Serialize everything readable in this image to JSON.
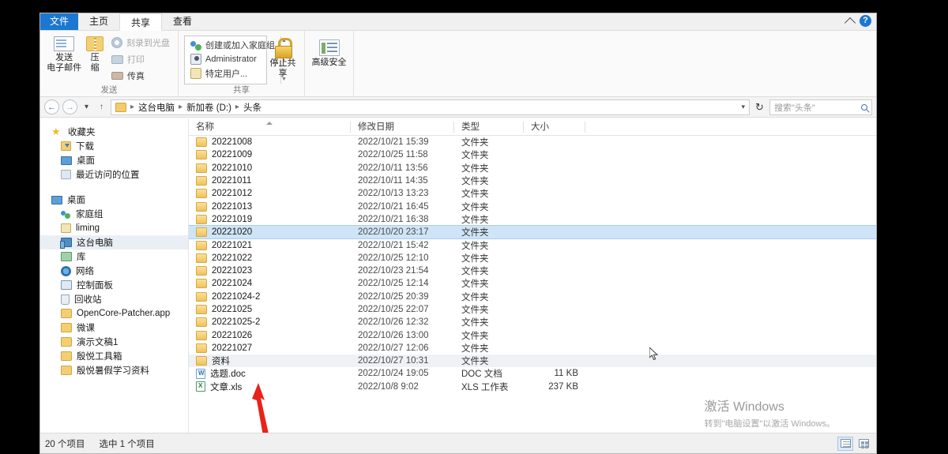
{
  "window": {
    "tabs": [
      {
        "label": "文件",
        "style": "file"
      },
      {
        "label": "主页",
        "style": "normal"
      },
      {
        "label": "共享",
        "style": "active"
      },
      {
        "label": "查看",
        "style": "normal"
      }
    ],
    "collapse_icon": "chevron-up-icon",
    "help_icon": "help-icon",
    "help_label": "?"
  },
  "ribbon": {
    "groups": [
      {
        "label": "发送",
        "big_buttons": [
          {
            "line1": "发送",
            "line2": "电子邮件",
            "icon": "email-icon"
          },
          {
            "line1": "压",
            "line2": "缩",
            "icon": "zip-folder-icon"
          }
        ],
        "small_buttons": [
          {
            "label": "刻录到光盘",
            "icon": "disc-icon",
            "disabled": true
          },
          {
            "label": "打印",
            "icon": "print-icon",
            "disabled": true
          },
          {
            "label": "传真",
            "icon": "fax-icon",
            "disabled": false
          }
        ]
      },
      {
        "label": "共享",
        "list_items": [
          {
            "label": "创建或加入家庭组",
            "icon": "homegroup-icon"
          },
          {
            "label": "Administrator",
            "icon": "user-icon"
          },
          {
            "label": "特定用户...",
            "icon": "users-icon"
          }
        ],
        "big_buttons": [
          {
            "line1": "停止共享",
            "line2": "",
            "icon": "lock-icon"
          }
        ]
      },
      {
        "label": "",
        "big_buttons": [
          {
            "line1": "高级安全",
            "line2": "",
            "icon": "advanced-security-icon"
          }
        ]
      }
    ]
  },
  "addressbar": {
    "back_icon": "back-arrow-icon",
    "forward_icon": "forward-arrow-icon",
    "history_icon": "chevron-down-icon",
    "up_icon": "up-arrow-icon",
    "breadcrumbs": [
      "这台电脑",
      "新加卷 (D:)",
      "头条"
    ],
    "dropdown_icon": "chevron-down-icon",
    "refresh_icon": "refresh-icon",
    "refresh_glyph": "↻",
    "search_placeholder": "搜索\"头条\"",
    "search_icon": "search-icon"
  },
  "sidebar": {
    "sections": [
      {
        "items": [
          {
            "label": "收藏夹",
            "icon": "star-icon",
            "indent": false,
            "selected": false
          },
          {
            "label": "下载",
            "icon": "downloads-icon",
            "indent": true,
            "selected": false
          },
          {
            "label": "桌面",
            "icon": "desktop-icon",
            "indent": true,
            "selected": false
          },
          {
            "label": "最近访问的位置",
            "icon": "recent-places-icon",
            "indent": true,
            "selected": false
          }
        ]
      },
      {
        "items": [
          {
            "label": "桌面",
            "icon": "desktop-icon",
            "indent": false,
            "selected": false
          },
          {
            "label": "家庭组",
            "icon": "homegroup-icon",
            "indent": true,
            "selected": false
          },
          {
            "label": "liming",
            "icon": "user-folder-icon",
            "indent": true,
            "selected": false
          },
          {
            "label": "这台电脑",
            "icon": "this-pc-icon",
            "indent": true,
            "selected": true
          },
          {
            "label": "库",
            "icon": "library-icon",
            "indent": true,
            "selected": false
          },
          {
            "label": "网络",
            "icon": "network-icon",
            "indent": true,
            "selected": false
          },
          {
            "label": "控制面板",
            "icon": "control-panel-icon",
            "indent": true,
            "selected": false
          },
          {
            "label": "回收站",
            "icon": "recycle-bin-icon",
            "indent": true,
            "selected": false
          },
          {
            "label": "OpenCore-Patcher.app",
            "icon": "folder-icon",
            "indent": true,
            "selected": false
          },
          {
            "label": "微课",
            "icon": "folder-icon",
            "indent": true,
            "selected": false
          },
          {
            "label": "演示文稿1",
            "icon": "folder-icon",
            "indent": true,
            "selected": false
          },
          {
            "label": "殷悦工具箱",
            "icon": "folder-icon",
            "indent": true,
            "selected": false
          },
          {
            "label": "殷悦暑假学习资料",
            "icon": "folder-icon",
            "indent": true,
            "selected": false
          }
        ]
      }
    ]
  },
  "filelist": {
    "columns": [
      {
        "key": "name",
        "label": "名称",
        "sorted": "asc"
      },
      {
        "key": "date",
        "label": "修改日期",
        "sorted": ""
      },
      {
        "key": "type",
        "label": "类型",
        "sorted": ""
      },
      {
        "key": "size",
        "label": "大小",
        "sorted": ""
      }
    ],
    "rows": [
      {
        "name": "20221008",
        "date": "2022/10/21 15:39",
        "type": "文件夹",
        "size": "",
        "icon": "folder-icon",
        "state": ""
      },
      {
        "name": "20221009",
        "date": "2022/10/25 11:58",
        "type": "文件夹",
        "size": "",
        "icon": "folder-icon",
        "state": ""
      },
      {
        "name": "20221010",
        "date": "2022/10/11 13:56",
        "type": "文件夹",
        "size": "",
        "icon": "folder-icon",
        "state": ""
      },
      {
        "name": "20221011",
        "date": "2022/10/11 14:35",
        "type": "文件夹",
        "size": "",
        "icon": "folder-icon",
        "state": ""
      },
      {
        "name": "20221012",
        "date": "2022/10/13 13:23",
        "type": "文件夹",
        "size": "",
        "icon": "folder-icon",
        "state": ""
      },
      {
        "name": "20221013",
        "date": "2022/10/21 16:45",
        "type": "文件夹",
        "size": "",
        "icon": "folder-icon",
        "state": ""
      },
      {
        "name": "20221019",
        "date": "2022/10/21 16:38",
        "type": "文件夹",
        "size": "",
        "icon": "folder-icon",
        "state": ""
      },
      {
        "name": "20221020",
        "date": "2022/10/20 23:17",
        "type": "文件夹",
        "size": "",
        "icon": "folder-icon",
        "state": "selected"
      },
      {
        "name": "20221021",
        "date": "2022/10/21 15:42",
        "type": "文件夹",
        "size": "",
        "icon": "folder-icon",
        "state": ""
      },
      {
        "name": "20221022",
        "date": "2022/10/25 12:10",
        "type": "文件夹",
        "size": "",
        "icon": "folder-icon",
        "state": ""
      },
      {
        "name": "20221023",
        "date": "2022/10/23 21:54",
        "type": "文件夹",
        "size": "",
        "icon": "folder-icon",
        "state": ""
      },
      {
        "name": "20221024",
        "date": "2022/10/25 12:14",
        "type": "文件夹",
        "size": "",
        "icon": "folder-icon",
        "state": ""
      },
      {
        "name": "20221024-2",
        "date": "2022/10/25 20:39",
        "type": "文件夹",
        "size": "",
        "icon": "folder-icon",
        "state": ""
      },
      {
        "name": "20221025",
        "date": "2022/10/25 22:07",
        "type": "文件夹",
        "size": "",
        "icon": "folder-icon",
        "state": ""
      },
      {
        "name": "20221025-2",
        "date": "2022/10/26 12:32",
        "type": "文件夹",
        "size": "",
        "icon": "folder-icon",
        "state": ""
      },
      {
        "name": "20221026",
        "date": "2022/10/26 13:00",
        "type": "文件夹",
        "size": "",
        "icon": "folder-icon",
        "state": ""
      },
      {
        "name": "20221027",
        "date": "2022/10/27 12:06",
        "type": "文件夹",
        "size": "",
        "icon": "folder-icon",
        "state": ""
      },
      {
        "name": "资料",
        "date": "2022/10/27 10:31",
        "type": "文件夹",
        "size": "",
        "icon": "folder-icon",
        "state": "hover"
      },
      {
        "name": "选题.doc",
        "date": "2022/10/24 19:05",
        "type": "DOC 文档",
        "size": "11 KB",
        "icon": "word-doc-icon",
        "state": ""
      },
      {
        "name": "文章.xls",
        "date": "2022/10/8 9:02",
        "type": "XLS 工作表",
        "size": "237 KB",
        "icon": "excel-doc-icon",
        "state": ""
      }
    ]
  },
  "watermark": {
    "title": "激活 Windows",
    "subtitle": "转到\"电脑设置\"以激活 Windows。"
  },
  "statusbar": {
    "item_count": "20 个项目",
    "selected_count": "选中 1 个项目",
    "view_details_icon": "details-view-icon",
    "view_icons_icon": "large-icons-view-icon"
  },
  "annotation": {
    "arrow_color": "#e8231b",
    "arrow_icon": "red-arrow-annotation"
  }
}
